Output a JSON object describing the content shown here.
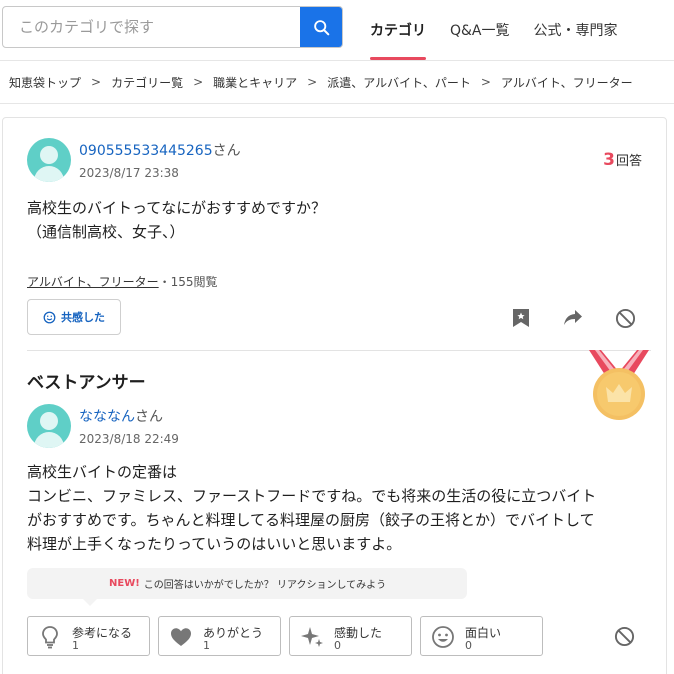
{
  "search": {
    "placeholder": "このカテゴリで探す"
  },
  "nav": {
    "tabs": [
      "カテゴリ",
      "Q&A一覧",
      "公式・専門家"
    ]
  },
  "breadcrumb": [
    "知恵袋トップ",
    "カテゴリー覧",
    "職業とキャリア",
    "派遣、アルバイト、パート",
    "アルバイト、フリーター"
  ],
  "question": {
    "user": "090555533445265",
    "honorific": "さん",
    "date": "2023/8/17 23:38",
    "answer_count": "3",
    "answer_count_label": "回答",
    "body_line1": "高校生のバイトってなにがおすすめですか？",
    "body_line2": "（通信制高校、女子、）",
    "category": "アルバイト、フリーター",
    "views": "・155閲覧",
    "empathy_label": "共感した"
  },
  "best_answer": {
    "title": "ベストアンサー",
    "user": "ななななん",
    "user_display": "なななん",
    "honorific": "さん",
    "date": "2023/8/18 22:49",
    "line1": "高校生バイトの定番は",
    "line2": "コンビニ、ファミレス、ファーストフードですね。でも将来の生活の役に立つバイト",
    "line3": "がおすすめです。ちゃんと料理してる料理屋の厨房（餃子の王将とか）でバイトして",
    "line4": "料理が上手くなったりっていうのはいいと思いますよ。",
    "prompt_new": "NEW!",
    "prompt_text": "この回答はいかがでしたか？ リアクションしてみよう",
    "reactions": [
      {
        "label": "参考になる",
        "count": "1",
        "icon": "lightbulb-icon"
      },
      {
        "label": "ありがとう",
        "count": "1",
        "icon": "heart-icon"
      },
      {
        "label": "感動した",
        "count": "0",
        "icon": "sparkle-icon"
      },
      {
        "label": "面白い",
        "count": "0",
        "icon": "smile-icon"
      }
    ]
  },
  "colors": {
    "accent_blue": "#1a73e8",
    "link_blue": "#1764c0",
    "accent_red": "#e8495e",
    "avatar": "#5fcfc7"
  }
}
